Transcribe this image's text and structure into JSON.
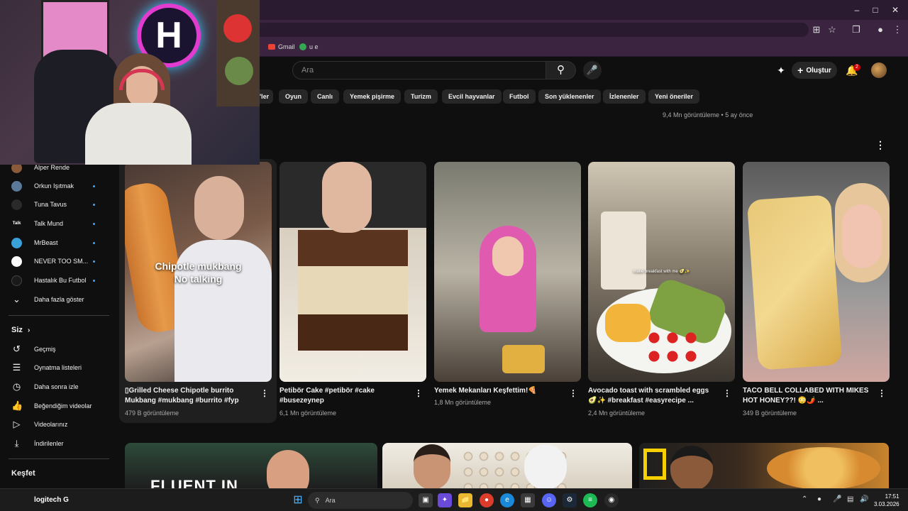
{
  "browser": {
    "bookmarks": [
      {
        "label": "Gmail",
        "color": "#ea4335"
      },
      {
        "label": "u e",
        "color": "#34a853"
      }
    ]
  },
  "header": {
    "search_placeholder": "Ara",
    "create_label": "Oluştur",
    "notification_count": "2"
  },
  "chips": [
    {
      "label": "'ler"
    },
    {
      "label": "Oyun"
    },
    {
      "label": "Canlı"
    },
    {
      "label": "Yemek pişirme"
    },
    {
      "label": "Turizm"
    },
    {
      "label": "Evcil hayvanlar"
    },
    {
      "label": "Futbol"
    },
    {
      "label": "Son yüklenenler"
    },
    {
      "label": "İzlenenler"
    },
    {
      "label": "Yeni öneriler"
    }
  ],
  "previous_meta": "9,4 Mn görüntüleme • 5 ay önce",
  "sidebar": {
    "subscriptions": [
      {
        "label": "Alper Rende",
        "avatar_color": "#8a5a3a",
        "avatar_text": ""
      },
      {
        "label": "Orkun Işıtmak",
        "avatar_color": "#5b7a9a",
        "avatar_text": ""
      },
      {
        "label": "Tuna Tavus",
        "avatar_color": "#2a2a2a",
        "avatar_text": ""
      },
      {
        "label": "Talk Mund",
        "avatar_color": "#111111",
        "avatar_text": "Talk"
      },
      {
        "label": "MrBeast",
        "avatar_color": "#3aa0d8",
        "avatar_text": ""
      },
      {
        "label": "NEVER TOO SM...",
        "avatar_color": "#ffffff",
        "avatar_text": ""
      },
      {
        "label": "Hastalık Bu Futbol",
        "avatar_color": "#1a1a1a",
        "avatar_text": ""
      }
    ],
    "show_more": "Daha fazla göster",
    "you_heading": "Siz",
    "you_items": [
      {
        "label": "Geçmiş",
        "icon": "history-icon"
      },
      {
        "label": "Oynatma listeleri",
        "icon": "playlists-icon"
      },
      {
        "label": "Daha sonra izle",
        "icon": "watch-later-icon"
      },
      {
        "label": "Beğendiğim videolar",
        "icon": "like-icon"
      },
      {
        "label": "Videolarınız",
        "icon": "your-videos-icon"
      },
      {
        "label": "İndirilenler",
        "icon": "download-icon"
      }
    ],
    "explore_heading": "Keşfet"
  },
  "videos": [
    {
      "title": "▯Grilled Cheese Chipotle  burrito Mukbang #mukbang #burrito #fyp シ...",
      "meta": "479 B görüntüleme",
      "overlay": "Chipotle mukbang\nNo talking"
    },
    {
      "title": "Petibör Cake #petibör #cake #busezeynep",
      "meta": "6,1 Mn görüntüleme",
      "overlay": ""
    },
    {
      "title": "Yemek Mekanları Keşfettim!🍕",
      "meta": "1,8 Mn görüntüleme",
      "overlay": ""
    },
    {
      "title": "Avocado toast with scrambled eggs 🥑✨ #breakfast #easyrecipe ...",
      "meta": "2,4 Mn görüntüleme",
      "overlay": "make breakfast with me 🥑✨"
    },
    {
      "title": "TACO BELL COLLABED WITH MIKES HOT HONEY??! 😳🌶️ ...",
      "meta": "349 B görüntüleme",
      "overlay": ""
    }
  ],
  "bottom_row_overlay": "FLUENT IN",
  "taskbar": {
    "search_label": "Ara",
    "time": "17:51",
    "date": "3.03.2026",
    "logitech_label": "logitech"
  }
}
